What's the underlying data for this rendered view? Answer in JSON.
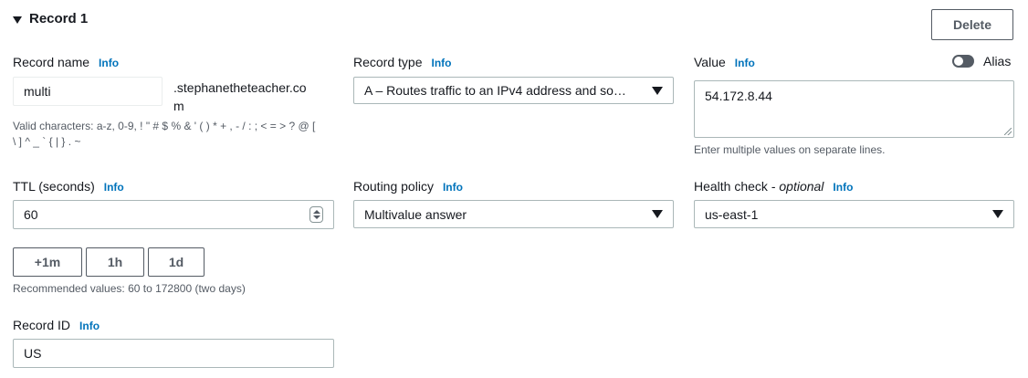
{
  "record": {
    "title": "Record 1",
    "delete_label": "Delete"
  },
  "info_label": "Info",
  "record_name": {
    "label": "Record name",
    "value": "multi",
    "domain_suffix_line1": ".stephanetheteacher.co",
    "domain_suffix_line2": "m",
    "hint_line1": "Valid characters: a-z, 0-9, ! \" # $ % & ' ( ) * + , - / : ; < = > ? @ [",
    "hint_line2": "\\ ] ^ _ ` { | } . ~"
  },
  "record_type": {
    "label": "Record type",
    "selected": "A – Routes traffic to an IPv4 address and so…"
  },
  "value": {
    "label": "Value",
    "text": "54.172.8.44",
    "alias_label": "Alias",
    "alias_enabled": false,
    "hint": "Enter multiple values on separate lines."
  },
  "ttl": {
    "label": "TTL (seconds)",
    "value": "60",
    "quick_buttons": [
      "+1m",
      "1h",
      "1d"
    ],
    "hint": "Recommended values: 60 to 172800 (two days)"
  },
  "routing_policy": {
    "label": "Routing policy",
    "selected": "Multivalue answer"
  },
  "health_check": {
    "label": "Health check - ",
    "label_optional": "optional",
    "selected": "us-east-1"
  },
  "record_id": {
    "label": "Record ID",
    "value": "US"
  },
  "colors": {
    "link": "#0073bb",
    "text": "#16191f",
    "secondary_text": "#545b64",
    "border": "#aab7b8"
  }
}
